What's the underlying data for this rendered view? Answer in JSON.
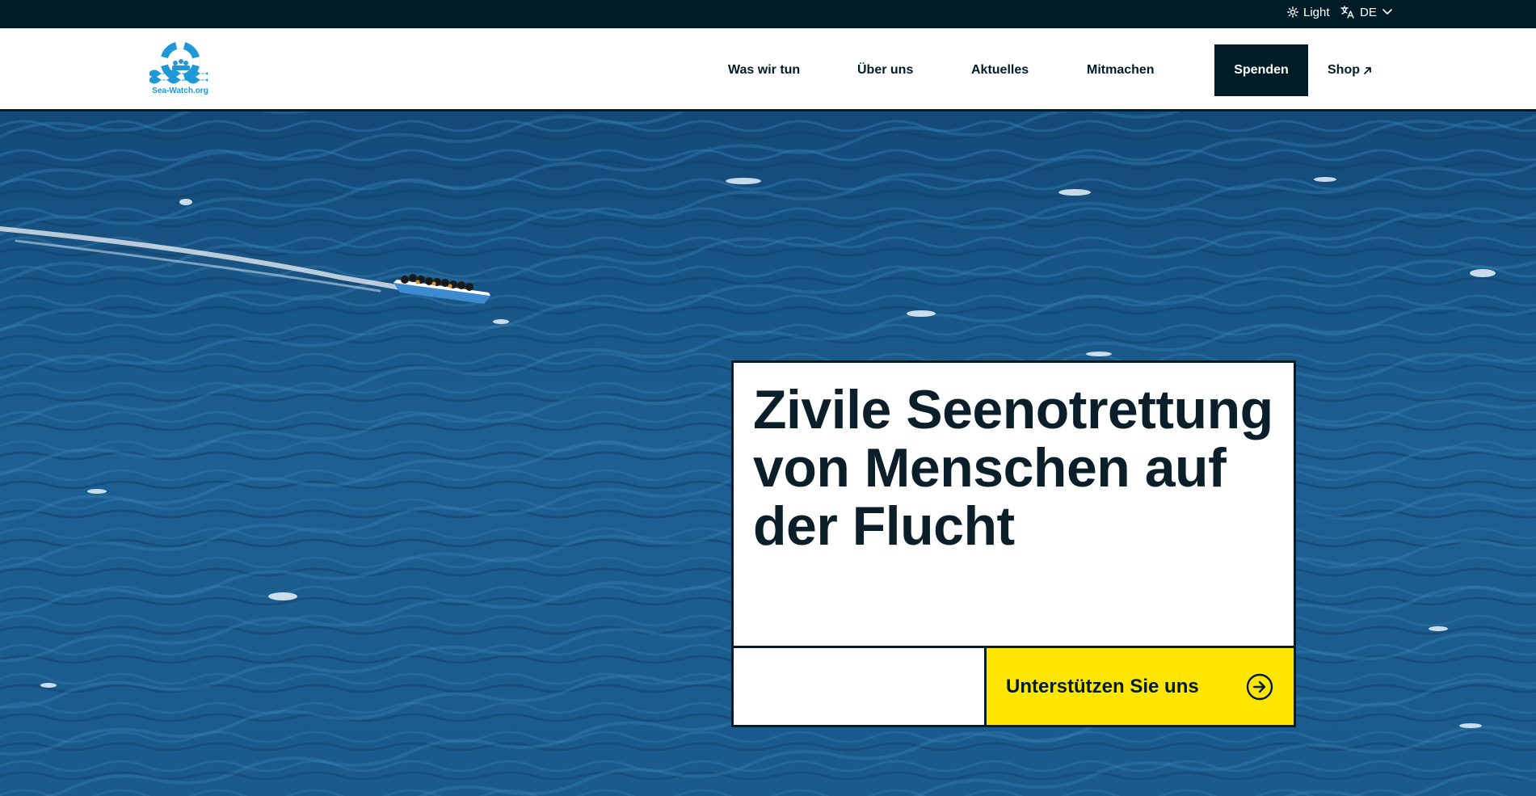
{
  "topbar": {
    "theme_label": "Light",
    "theme_icon": "sun-icon",
    "language_label": "DE",
    "language_icon": "translate-icon"
  },
  "header": {
    "logo_text": "Sea-Watch.org",
    "nav": [
      {
        "label": "Was wir tun"
      },
      {
        "label": "Über uns"
      },
      {
        "label": "Aktuelles"
      },
      {
        "label": "Mitmachen"
      }
    ],
    "donate_label": "Spenden",
    "shop_label": "Shop"
  },
  "hero": {
    "headline": "Zivile Seenotrettung von Menschen auf der Flucht",
    "cta_label": "Unterstützen Sie uns",
    "cta_icon": "arrow-right-circle-icon"
  },
  "colors": {
    "dark": "#001d27",
    "accent_yellow": "#ffe500",
    "logo_blue": "#1f98d8",
    "sea": "#1d5f92"
  }
}
